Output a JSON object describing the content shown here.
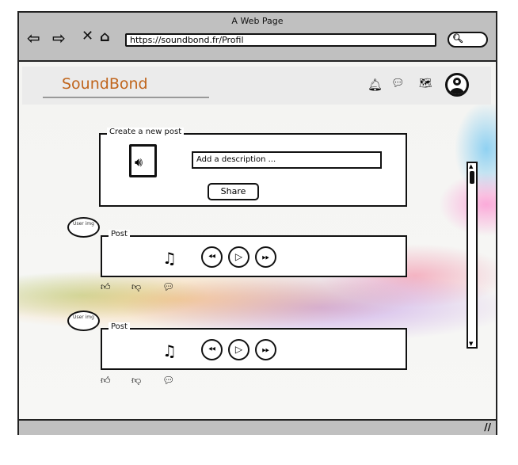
{
  "browser": {
    "title": "A Web Page",
    "url": "https://soundbond.fr/Profil",
    "icons": [
      "back-arrow-icon",
      "forward-arrow-icon",
      "close-icon",
      "home-icon",
      "search-icon"
    ]
  },
  "header": {
    "logo": "SoundBond",
    "icons": [
      "bell-icon",
      "chat-icon",
      "map-icon",
      "user-avatar-icon"
    ],
    "logo_color": "#c0651c"
  },
  "create_post": {
    "legend": "Create a new post",
    "description_placeholder": "Add a description ...",
    "share_label": "Share",
    "icon": "audio-file-icon"
  },
  "posts": [
    {
      "user_img": "User img",
      "legend": "Post"
    },
    {
      "user_img": "User img",
      "legend": "Post"
    }
  ]
}
